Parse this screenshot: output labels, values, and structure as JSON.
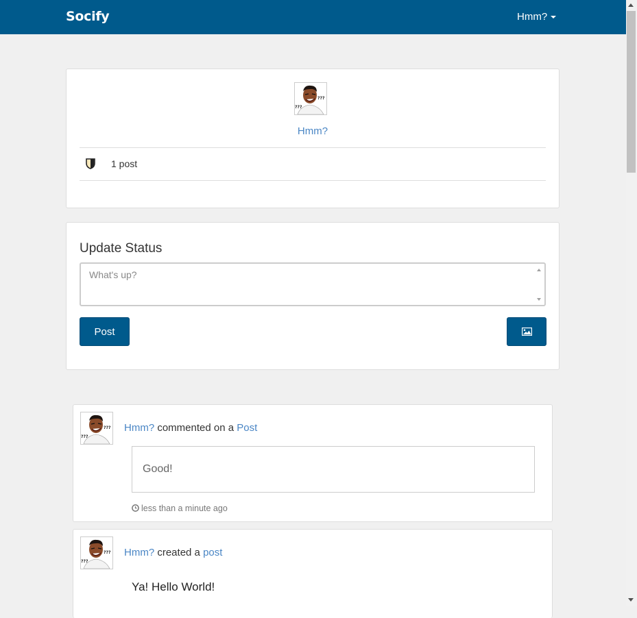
{
  "navbar": {
    "brand": "Socify",
    "user_menu_label": "Hmm?"
  },
  "profile": {
    "name": "Hmm?",
    "post_count": "1 post",
    "stat_icon": "shield-icon"
  },
  "status": {
    "title": "Update Status",
    "placeholder": "What's up?",
    "post_button": "Post",
    "image_button_icon": "image-icon"
  },
  "feed": [
    {
      "actor": "Hmm?",
      "action": "commented on a",
      "object_link": "Post",
      "comment": "Good!",
      "timestamp": "less than a minute ago"
    },
    {
      "actor": "Hmm?",
      "action": "created a",
      "object_link": "post",
      "content": "Ya! Hello World!"
    }
  ],
  "colors": {
    "brand": "#005a8c",
    "link": "#4a86c5",
    "background": "#f0f0f0"
  }
}
